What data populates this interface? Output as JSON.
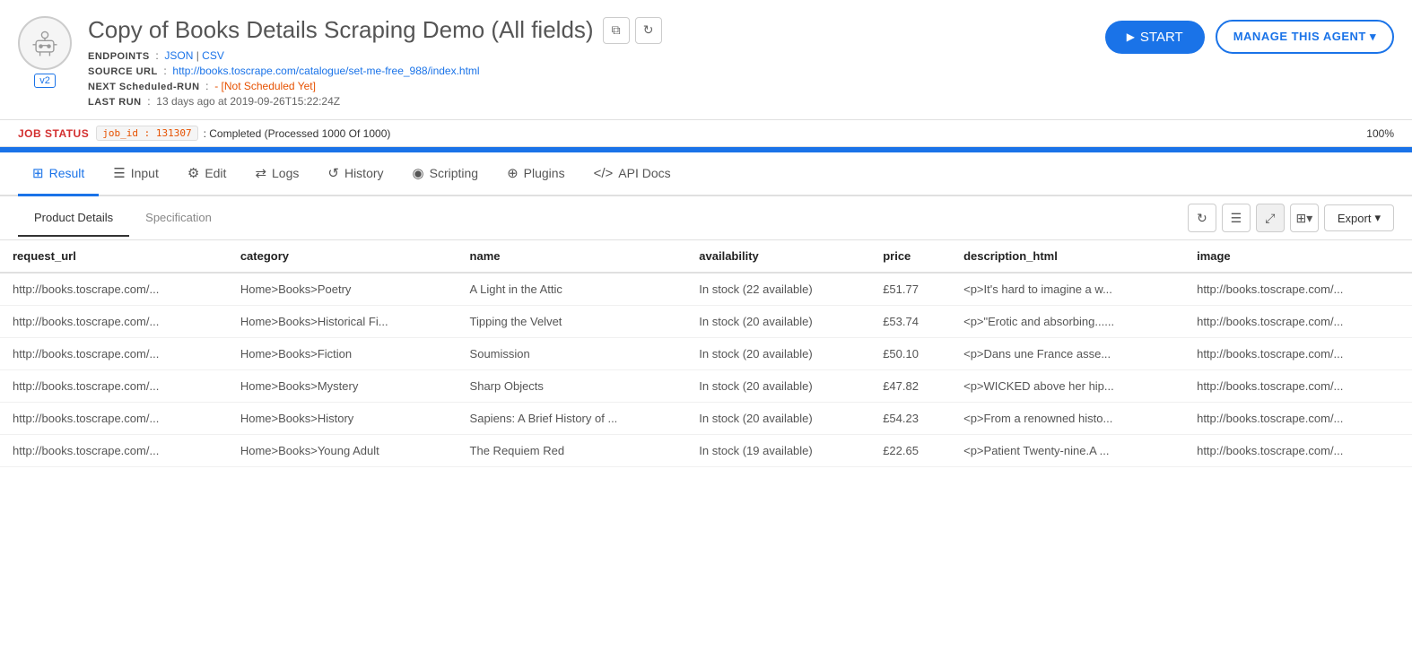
{
  "header": {
    "title": "Copy of Books Details Scraping Demo (All fields)",
    "version": "v2",
    "endpoints_label": "ENDPOINTS",
    "json_label": "JSON",
    "csv_label": "CSV",
    "source_url_label": "SOURCE URL",
    "source_url": "http://books.toscrape.com/catalogue/set-me-free_988/index.html",
    "next_run_label": "NEXT Scheduled-RUN",
    "next_run_value": "- [Not Scheduled Yet]",
    "last_run_label": "LAST RUN",
    "last_run_value": "13 days ago at 2019-09-26T15:22:24Z",
    "copy_icon": "⧉",
    "refresh_icon": "↻",
    "start_label": "START",
    "manage_label": "MANAGE THIS AGENT ▾"
  },
  "job_status": {
    "label": "JOB STATUS",
    "job_id": "job_id : 131307",
    "status_text": ": Completed (Processed 1000 Of 1000)",
    "percent": "100%",
    "progress": 100
  },
  "tabs": [
    {
      "id": "result",
      "label": "Result",
      "icon": "⊞",
      "active": true
    },
    {
      "id": "input",
      "label": "Input",
      "icon": "☰",
      "active": false
    },
    {
      "id": "edit",
      "label": "Edit",
      "icon": "⚙",
      "active": false
    },
    {
      "id": "logs",
      "label": "Logs",
      "icon": "⇄",
      "active": false
    },
    {
      "id": "history",
      "label": "History",
      "icon": "↺",
      "active": false
    },
    {
      "id": "scripting",
      "label": "Scripting",
      "icon": "◉",
      "active": false
    },
    {
      "id": "plugins",
      "label": "Plugins",
      "icon": "⊕",
      "active": false
    },
    {
      "id": "api_docs",
      "label": "API Docs",
      "icon": "⟨⟩",
      "active": false
    }
  ],
  "subtabs": [
    {
      "id": "product_details",
      "label": "Product Details",
      "active": true
    },
    {
      "id": "specification",
      "label": "Specification",
      "active": false
    }
  ],
  "table": {
    "columns": [
      "request_url",
      "category",
      "name",
      "availability",
      "price",
      "description_html",
      "image"
    ],
    "rows": [
      {
        "request_url": "http://books.toscrape.com/...",
        "category": "Home>Books>Poetry",
        "name": "A Light in the Attic",
        "availability": "In stock (22 available)",
        "price": "£51.77",
        "description_html": "<p>It's hard to imagine a w...",
        "image": "http://books.toscrape.com/..."
      },
      {
        "request_url": "http://books.toscrape.com/...",
        "category": "Home>Books>Historical Fi...",
        "name": "Tipping the Velvet",
        "availability": "In stock (20 available)",
        "price": "£53.74",
        "description_html": "<p>\"Erotic and absorbing......",
        "image": "http://books.toscrape.com/..."
      },
      {
        "request_url": "http://books.toscrape.com/...",
        "category": "Home>Books>Fiction",
        "name": "Soumission",
        "availability": "In stock (20 available)",
        "price": "£50.10",
        "description_html": "<p>Dans une France asse...",
        "image": "http://books.toscrape.com/..."
      },
      {
        "request_url": "http://books.toscrape.com/...",
        "category": "Home>Books>Mystery",
        "name": "Sharp Objects",
        "availability": "In stock (20 available)",
        "price": "£47.82",
        "description_html": "<p>WICKED above her hip...",
        "image": "http://books.toscrape.com/..."
      },
      {
        "request_url": "http://books.toscrape.com/...",
        "category": "Home>Books>History",
        "name": "Sapiens: A Brief History of ...",
        "availability": "In stock (20 available)",
        "price": "£54.23",
        "description_html": "<p>From a renowned histo...",
        "image": "http://books.toscrape.com/..."
      },
      {
        "request_url": "http://books.toscrape.com/...",
        "category": "Home>Books>Young Adult",
        "name": "The Requiem Red",
        "availability": "In stock (19 available)",
        "price": "£22.65",
        "description_html": "<p>Patient Twenty-nine.A ...",
        "image": "http://books.toscrape.com/..."
      }
    ]
  },
  "colors": {
    "accent": "#1a73e8",
    "not_scheduled": "#e65100",
    "job_id_color": "#e65100",
    "error_label": "#d32f2f"
  }
}
